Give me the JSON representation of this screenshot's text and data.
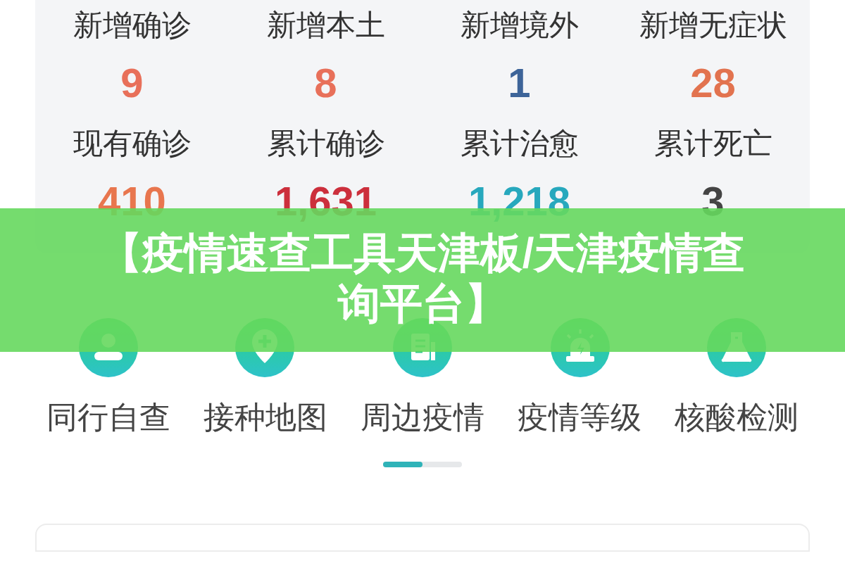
{
  "stats": [
    {
      "label": "新增确诊",
      "value": "9",
      "color": "#e8705a"
    },
    {
      "label": "新增本土",
      "value": "8",
      "color": "#e8705a"
    },
    {
      "label": "新增境外",
      "value": "1",
      "color": "#3d6499"
    },
    {
      "label": "新增无症状",
      "value": "28",
      "color": "#e2734f"
    },
    {
      "label": "现有确诊",
      "value": "410",
      "color": "#e8764e"
    },
    {
      "label": "累计确诊",
      "value": "1,631",
      "color": "#cc2f3c"
    },
    {
      "label": "累计治愈",
      "value": "1,218",
      "color": "#27a8bd"
    },
    {
      "label": "累计死亡",
      "value": "3",
      "color": "#444444"
    }
  ],
  "banner": {
    "title": "【疫情速查工具天津板/天津疫情查询平台】"
  },
  "features": [
    {
      "label": "同行自查",
      "kind": "person"
    },
    {
      "label": "接种地图",
      "kind": "pin"
    },
    {
      "label": "周边疫情",
      "kind": "document"
    },
    {
      "label": "疫情等级",
      "kind": "siren"
    },
    {
      "label": "核酸检测",
      "kind": "flask"
    }
  ]
}
